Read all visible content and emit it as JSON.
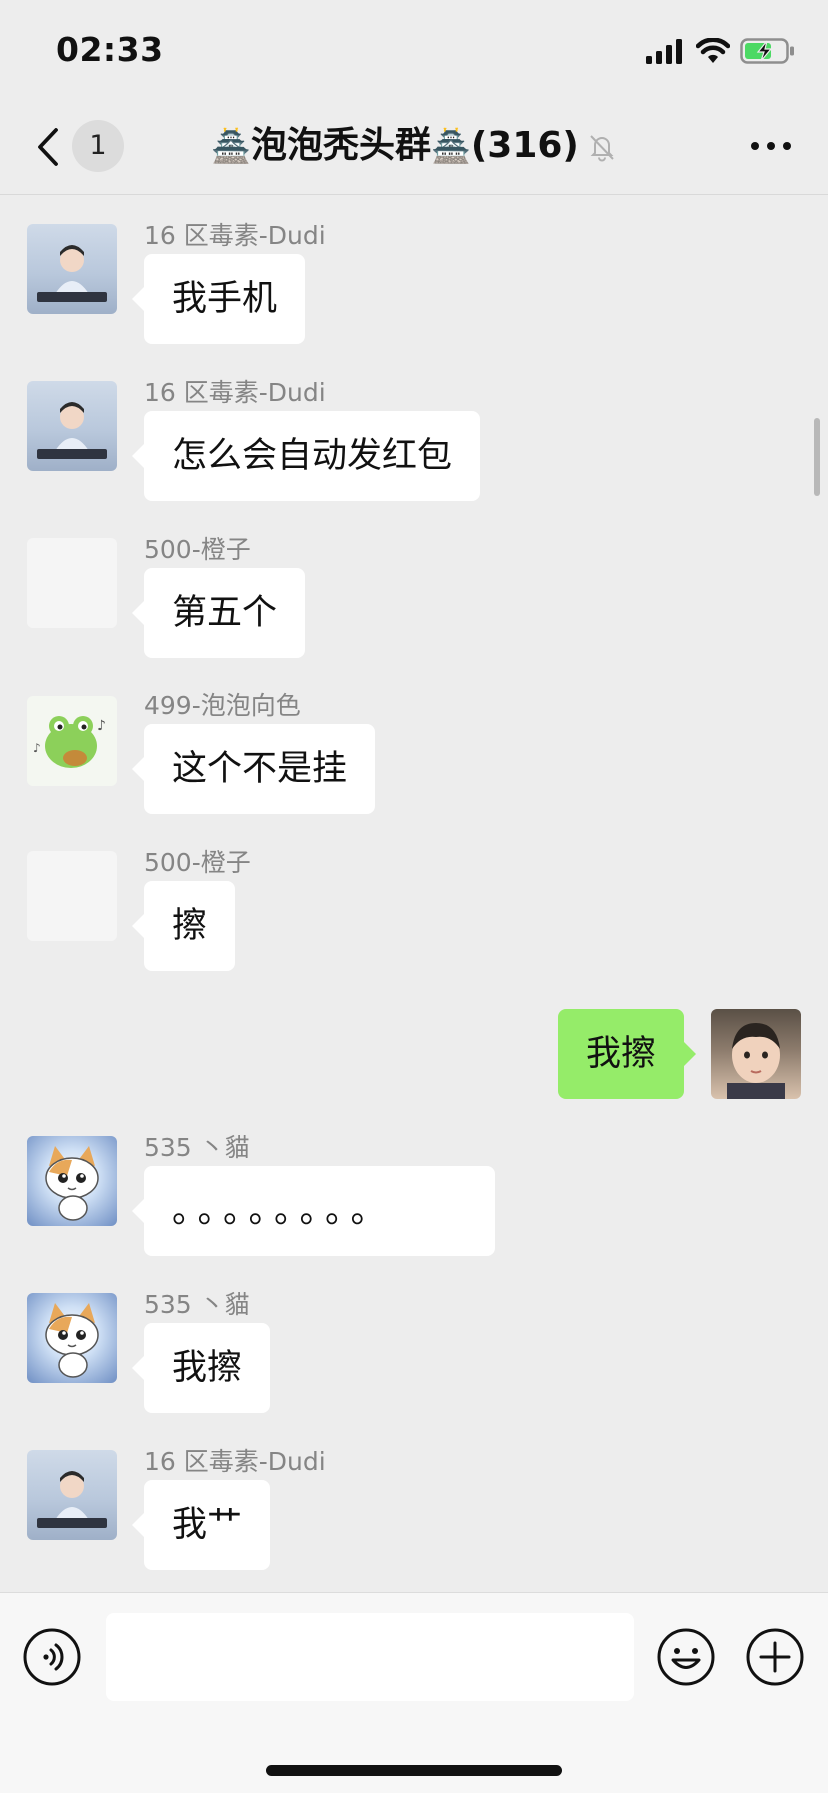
{
  "status_bar": {
    "time": "02:33"
  },
  "nav": {
    "unread_count": "1",
    "group_name": "泡泡秃头群",
    "member_count": "(316)",
    "title_emoji": "🏯"
  },
  "messages": [
    {
      "sender": "16 区毒素-Dudi",
      "text": "我手机",
      "direction": "in",
      "avatar": "girl-keyboard-avatar"
    },
    {
      "sender": "16 区毒素-Dudi",
      "text": "怎么会自动发红包",
      "direction": "in",
      "avatar": "girl-keyboard-avatar"
    },
    {
      "sender": "500-橙子",
      "text": "第五个",
      "direction": "in",
      "avatar": "blank-avatar"
    },
    {
      "sender": "499-泡泡向色",
      "text": "这个不是挂",
      "direction": "in",
      "avatar": "frog-guitar-avatar"
    },
    {
      "sender": "500-橙子",
      "text": "擦",
      "direction": "in",
      "avatar": "blank-avatar"
    },
    {
      "sender": "",
      "text": "我擦",
      "direction": "out",
      "avatar": "boy-photo-avatar"
    },
    {
      "sender": "535 丶貓",
      "text": "。。。。。。。。",
      "direction": "in",
      "avatar": "cat-sticker-avatar"
    },
    {
      "sender": "535 丶貓",
      "text": "我擦",
      "direction": "in",
      "avatar": "cat-sticker-avatar"
    },
    {
      "sender": "16 区毒素-Dudi",
      "text": "我艹",
      "direction": "in",
      "avatar": "girl-keyboard-avatar"
    }
  ],
  "input": {
    "value": "",
    "placeholder": ""
  },
  "icons": {
    "back": "chevron-left-icon",
    "mute": "bell-slash-icon",
    "more": "more-dots-icon",
    "voice": "voice-icon",
    "emoji": "emoji-smile-icon",
    "plus": "plus-icon"
  },
  "colors": {
    "background": "#ededed",
    "incoming_bubble": "#ffffff",
    "outgoing_bubble": "#95ec69",
    "sender_name": "#858585"
  }
}
